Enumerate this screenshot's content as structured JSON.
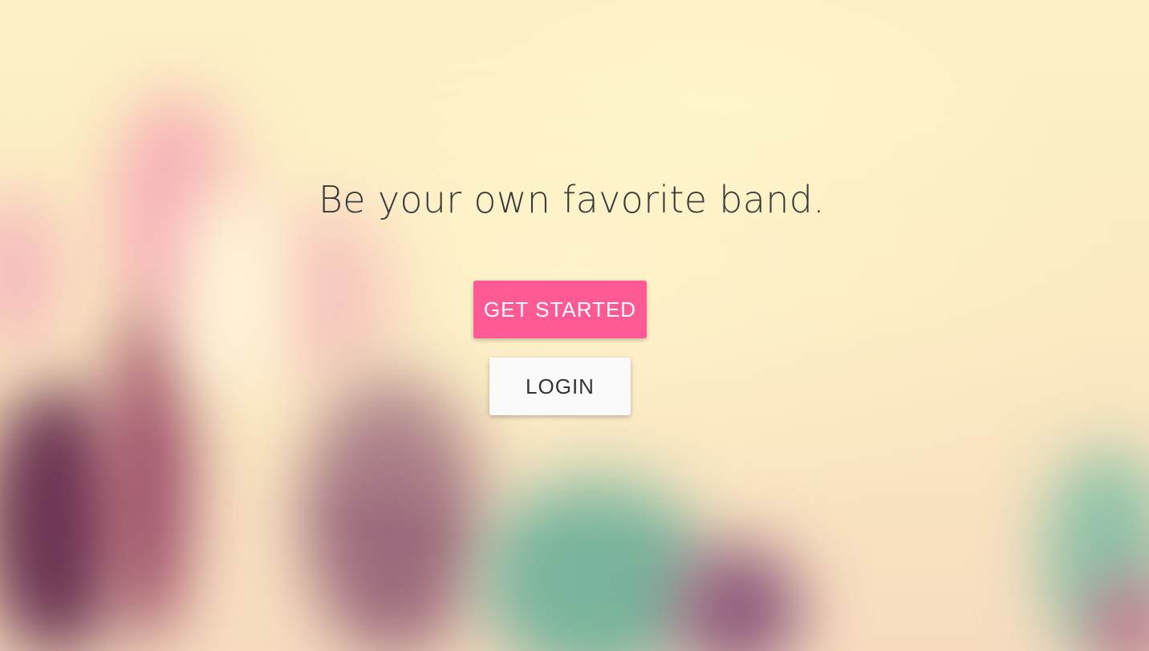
{
  "hero": {
    "headline": "Be your own favorite band."
  },
  "actions": {
    "get_started_label": "GET STARTED",
    "login_label": "LOGIN"
  },
  "colors": {
    "primary_button": "#ff5996",
    "secondary_button": "#fafafa",
    "headline_text": "#3a3a3a"
  }
}
